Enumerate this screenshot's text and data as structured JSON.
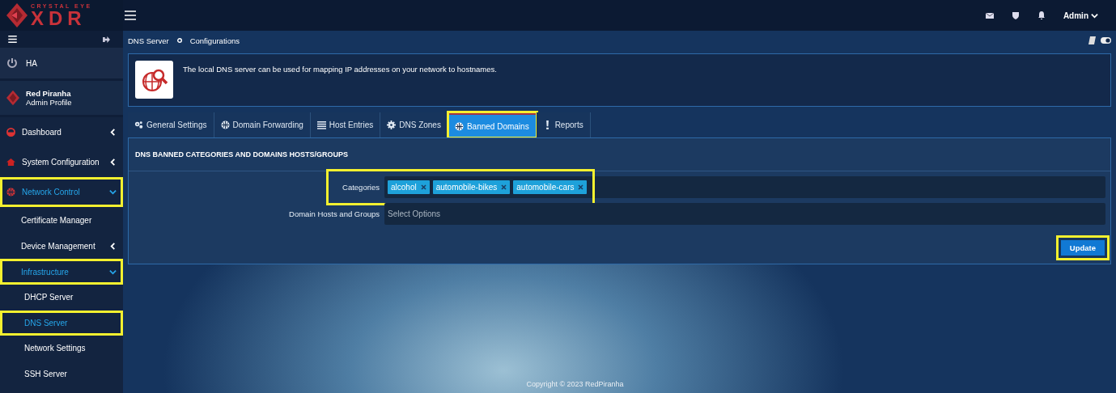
{
  "logo": {
    "top": "CRYSTAL EYE",
    "main": "XDR"
  },
  "topbar": {
    "user": "Admin"
  },
  "sidebar": {
    "ha": "HA",
    "profile": {
      "name": "Red Piranha",
      "role": "Admin Profile"
    },
    "items": [
      {
        "label": "Dashboard",
        "active": false,
        "expanded": false,
        "highlighted": false
      },
      {
        "label": "System Configuration",
        "active": false,
        "expanded": false,
        "highlighted": false
      },
      {
        "label": "Network Control",
        "active": true,
        "expanded": true,
        "highlighted": true,
        "children": [
          {
            "label": "Certificate Manager",
            "active": false,
            "highlighted": false
          },
          {
            "label": "Device Management",
            "active": false,
            "expanded": false,
            "highlighted": false
          },
          {
            "label": "Infrastructure",
            "active": true,
            "expanded": true,
            "highlighted": true,
            "children": [
              {
                "label": "DHCP Server",
                "active": false,
                "highlighted": false
              },
              {
                "label": "DNS Server",
                "active": true,
                "highlighted": true
              },
              {
                "label": "Network Settings",
                "active": false,
                "highlighted": false
              },
              {
                "label": "SSH Server",
                "active": false,
                "highlighted": false
              }
            ]
          }
        ]
      }
    ]
  },
  "breadcrumb": [
    "DNS Server",
    "Configurations"
  ],
  "info": "The local DNS server can be used for mapping IP addresses on your network to hostnames.",
  "tabs": [
    {
      "label": "General Settings",
      "selected": false,
      "highlighted": false
    },
    {
      "label": "Domain Forwarding",
      "selected": false,
      "highlighted": false
    },
    {
      "label": "Host Entries",
      "selected": false,
      "highlighted": false
    },
    {
      "label": "DNS Zones",
      "selected": false,
      "highlighted": false
    },
    {
      "label": "Banned Domains",
      "selected": true,
      "highlighted": true
    },
    {
      "label": "Reports",
      "selected": false,
      "highlighted": false
    }
  ],
  "panel": {
    "title": "DNS BANNED CATEGORIES AND DOMAINS HOSTS/GROUPS",
    "fields": [
      {
        "label": "Categories",
        "tags": [
          "alcohol",
          "automobile-bikes",
          "automobile-cars"
        ],
        "highlighted": true
      },
      {
        "label": "Domain Hosts and Groups",
        "placeholder": "Select Options",
        "highlighted": false
      }
    ],
    "button": {
      "label": "Update",
      "highlighted": true
    }
  },
  "footer": "Copyright © 2023 RedPiranha"
}
